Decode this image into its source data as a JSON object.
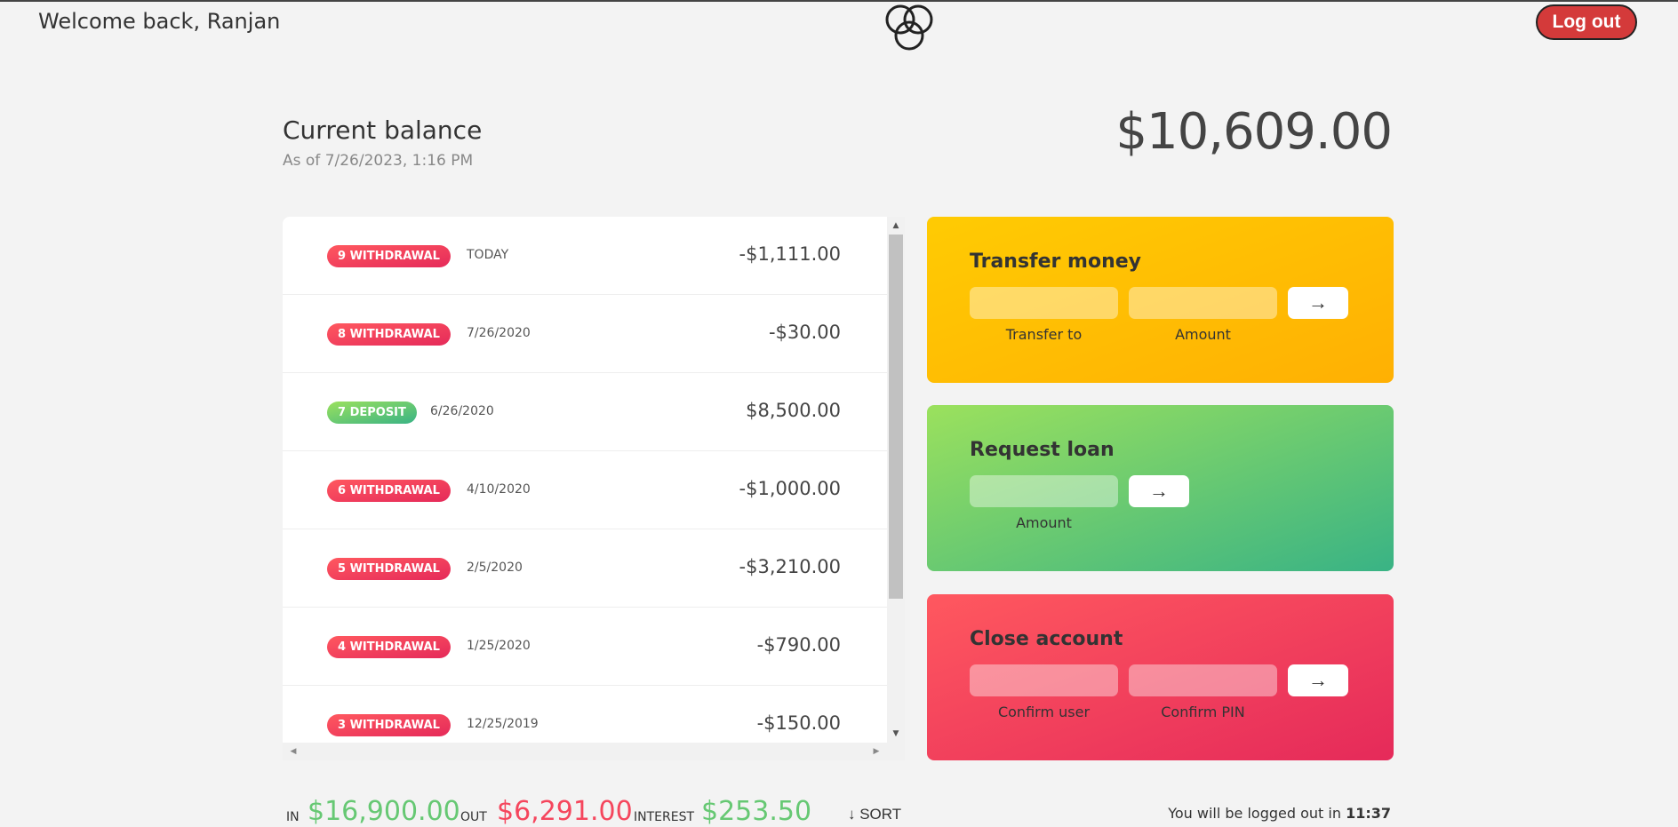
{
  "nav": {
    "welcome": "Welcome back, Ranjan",
    "logout_label": "Log out"
  },
  "balance": {
    "label": "Current balance",
    "as_of_prefix": "As of",
    "as_of_date": "7/26/2023, 1:16 PM",
    "value": "$10,609.00"
  },
  "movements": [
    {
      "index": "9",
      "type": "withdrawal",
      "type_label": "9 WITHDRAWAL",
      "date": "TODAY",
      "value": "-$1,111.00"
    },
    {
      "index": "8",
      "type": "withdrawal",
      "type_label": "8 WITHDRAWAL",
      "date": "7/26/2020",
      "value": "-$30.00"
    },
    {
      "index": "7",
      "type": "deposit",
      "type_label": "7 DEPOSIT",
      "date": "6/26/2020",
      "value": "$8,500.00"
    },
    {
      "index": "6",
      "type": "withdrawal",
      "type_label": "6 WITHDRAWAL",
      "date": "4/10/2020",
      "value": "-$1,000.00"
    },
    {
      "index": "5",
      "type": "withdrawal",
      "type_label": "5 WITHDRAWAL",
      "date": "2/5/2020",
      "value": "-$3,210.00"
    },
    {
      "index": "4",
      "type": "withdrawal",
      "type_label": "4 WITHDRAWAL",
      "date": "1/25/2020",
      "value": "-$790.00"
    },
    {
      "index": "3",
      "type": "withdrawal",
      "type_label": "3 WITHDRAWAL",
      "date": "12/25/2019",
      "value": "-$150.00"
    }
  ],
  "operations": {
    "transfer": {
      "title": "Transfer money",
      "field1_label": "Transfer to",
      "field2_label": "Amount",
      "button_icon": "arrow-right-icon",
      "button_glyph": "→"
    },
    "loan": {
      "title": "Request loan",
      "field1_label": "Amount",
      "button_icon": "arrow-right-icon",
      "button_glyph": "→"
    },
    "close": {
      "title": "Close account",
      "field1_label": "Confirm user",
      "field2_label": "Confirm PIN",
      "button_icon": "arrow-right-icon",
      "button_glyph": "→"
    }
  },
  "summary": {
    "in_label": "In",
    "in_value": "$16,900.00",
    "out_label": "Out",
    "out_value": "$6,291.00",
    "interest_label": "Interest",
    "interest_value": "$253.50",
    "sort_label": "↓ SORT"
  },
  "timer": {
    "prefix": "You will be logged out in",
    "value": "11:37"
  },
  "colors": {
    "background": "#f3f3f3",
    "withdrawal": "#e52a5a",
    "deposit": "#39b385",
    "transfer_card": "#ffcb03",
    "loan_card": "#9be15d",
    "close_card": "#ff585f",
    "logout": "#d43a3a",
    "positive": "#66c873",
    "negative": "#f5465d"
  }
}
